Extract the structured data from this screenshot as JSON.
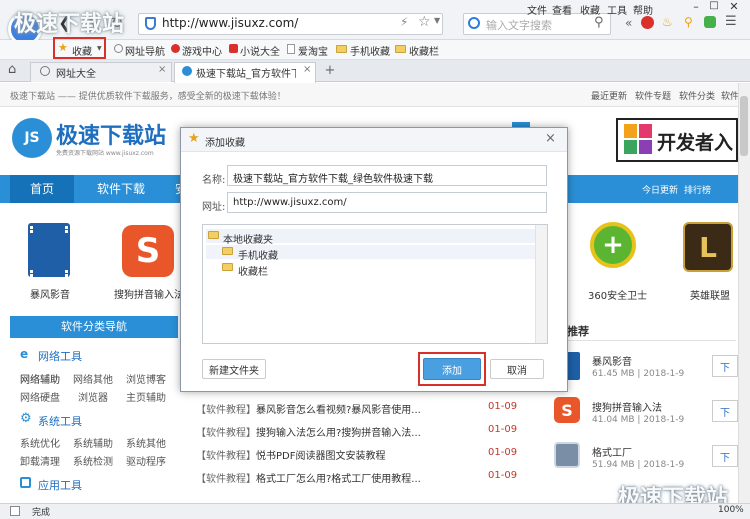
{
  "window": {
    "url": "http://www.jisuxz.com/",
    "search_placeholder": "输入文字搜索",
    "menu": [
      "文件",
      "查看",
      "收藏",
      "工具",
      "帮助"
    ],
    "watermark": "极速下载站"
  },
  "bookmarks_bar": {
    "favorites": "收藏",
    "items": [
      "网址导航",
      "游戏中心",
      "小说大全",
      "爱淘宝",
      "手机收藏",
      "收藏栏"
    ]
  },
  "tabs": [
    {
      "label": "网址大全"
    },
    {
      "label": "极速下载站_官方软件下"
    }
  ],
  "site": {
    "topbar_text": "极速下载站 —— 提供优质软件下载服务，感受全新的极速下载体验！",
    "topbar_links": [
      "最近更新",
      "软件专题",
      "软件分类",
      "软件"
    ],
    "logo_main": "极速下载站",
    "logo_sub": "免费资源下载网站 www.jisuxz.com",
    "banner_text": "开发者入",
    "nav": [
      "首页",
      "软件下载",
      "安"
    ],
    "nav_right": [
      "今日更新",
      "排行榜"
    ],
    "apps_left": [
      {
        "name": "暴风影音"
      },
      {
        "name": "搜狗拼音输入法"
      }
    ],
    "apps_right": [
      {
        "name": "360安全卫士"
      },
      {
        "name": "英雄联盟"
      }
    ],
    "category_nav_title": "软件分类导航",
    "categories": [
      {
        "title": "网络工具",
        "items": [
          "网络辅助",
          "网络其他",
          "浏览博客",
          "网络硬盘",
          "浏览器",
          "主页辅助"
        ]
      },
      {
        "title": "系统工具",
        "items": [
          "系统优化",
          "系统辅助",
          "系统其他",
          "卸载清理",
          "系统检测",
          "驱动程序"
        ]
      },
      {
        "title": "应用工具",
        "items": []
      }
    ],
    "articles": [
      {
        "tag": "【软件教程】",
        "title": "暴风影音怎么看视频?暴风影音使用...",
        "date": "01-09"
      },
      {
        "tag": "【软件教程】",
        "title": "搜狗输入法怎么用?搜狗拼音输入法...",
        "date": "01-09"
      },
      {
        "tag": "【软件教程】",
        "title": "悦书PDF阅读器图文安装教程",
        "date": "01-09"
      },
      {
        "tag": "【软件教程】",
        "title": "格式工厂怎么用?格式工厂使用教程...",
        "date": "01-09"
      }
    ],
    "recommend_title": "推荐",
    "recommend": [
      {
        "name": "暴风影音",
        "meta": "61.45 MB | 2018-1-9",
        "btn": "下"
      },
      {
        "name": "搜狗拼音输入法",
        "meta": "41.04 MB | 2018-1-9",
        "btn": "下"
      },
      {
        "name": "格式工厂",
        "meta": "51.94 MB | 2018-1-9",
        "btn": "下"
      }
    ]
  },
  "dialog": {
    "title": "添加收藏",
    "name_label": "名称:",
    "name_value": "极速下载站_官方软件下载_绿色软件极速下载",
    "url_label": "网址:",
    "url_value": "http://www.jisuxz.com/",
    "folders": {
      "root": "本地收藏夹",
      "children": [
        "手机收藏",
        "收藏栏"
      ]
    },
    "new_folder": "新建文件夹",
    "add": "添加",
    "cancel": "取消"
  },
  "status": {
    "text": "完成",
    "zoom": "100%"
  },
  "colors": {
    "nav_blue": "#2a8fd6",
    "highlight_red": "#d9302c",
    "add_btn": "#4a9fe0",
    "date_red": "#c0392b"
  }
}
